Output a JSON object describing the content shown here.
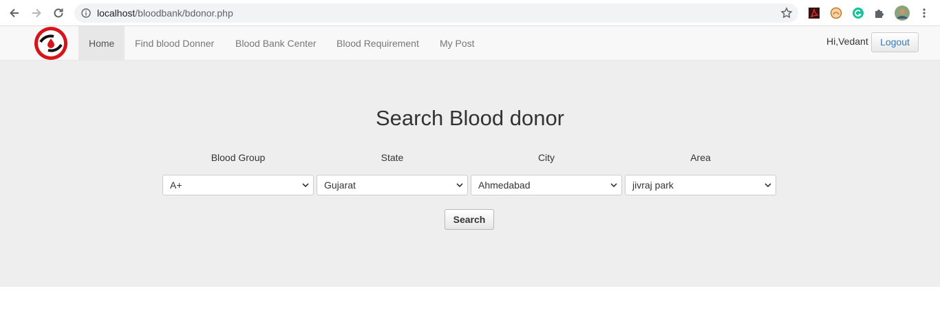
{
  "browser": {
    "url_host": "localhost",
    "url_path": "/bloodbank/bdonor.php"
  },
  "navbar": {
    "items": [
      {
        "label": "Home"
      },
      {
        "label": "Find blood Donner"
      },
      {
        "label": "Blood Bank Center"
      },
      {
        "label": "Blood Requirement"
      },
      {
        "label": "My Post"
      }
    ],
    "greeting": "Hi,Vedant",
    "logout_label": "Logout"
  },
  "search": {
    "title": "Search Blood donor",
    "fields": [
      {
        "label": "Blood Group",
        "value": "A+"
      },
      {
        "label": "State",
        "value": "Gujarat"
      },
      {
        "label": "City",
        "value": "Ahmedabad"
      },
      {
        "label": "Area",
        "value": "jivraj park"
      }
    ],
    "button_label": "Search"
  },
  "colors": {
    "navbar_bg": "#f8f8f8",
    "jumbotron_bg": "#eeeeee",
    "link_blue": "#337ab7",
    "logo_red": "#d7141a"
  },
  "icons": [
    "back-arrow-icon",
    "forward-arrow-icon",
    "reload-icon",
    "info-icon",
    "star-icon",
    "pdf-extension-icon",
    "extension-icon",
    "grammarly-icon",
    "puzzle-icon",
    "profile-avatar",
    "menu-dots-icon"
  ]
}
